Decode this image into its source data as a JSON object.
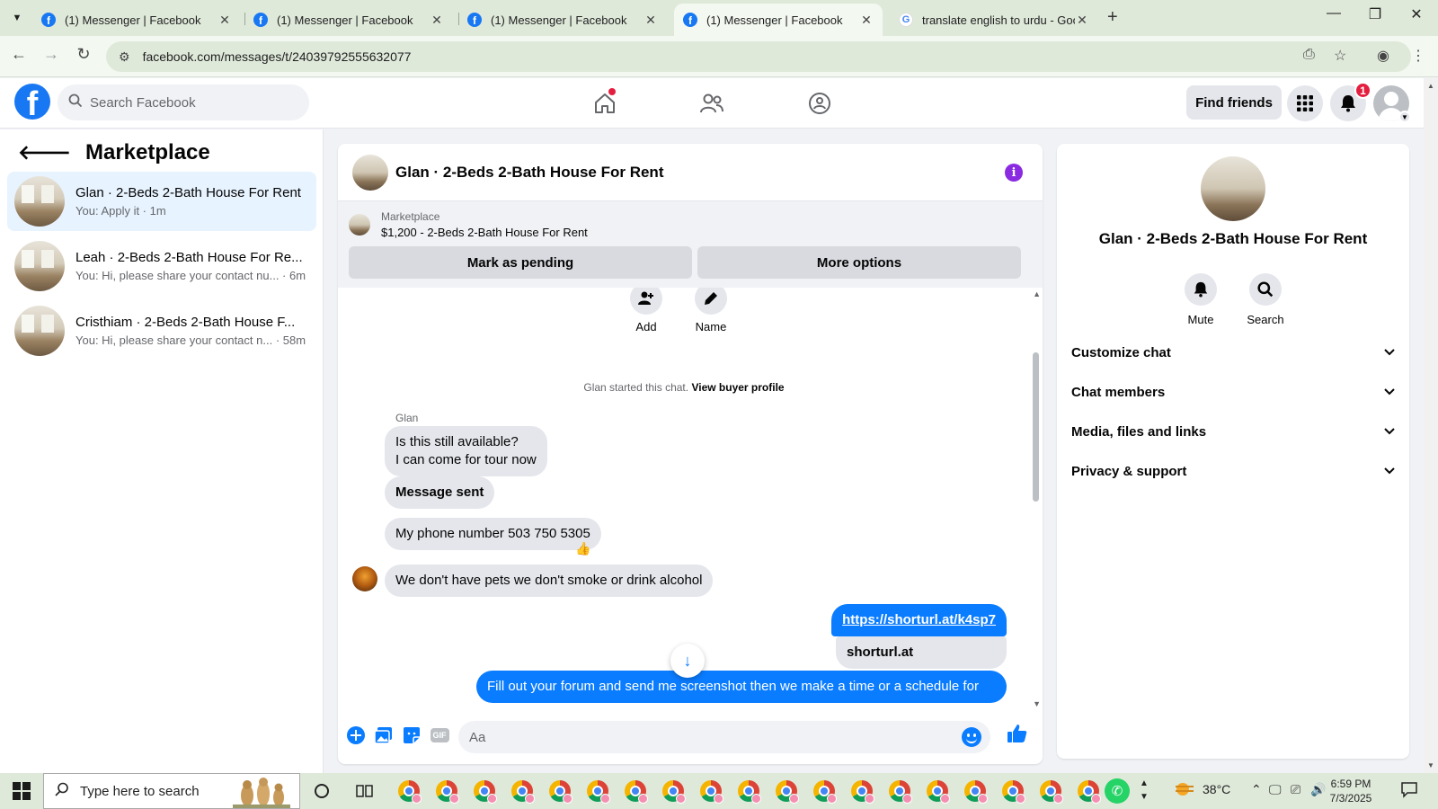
{
  "browser": {
    "tabs": [
      {
        "title": "(1) Messenger | Facebook",
        "active": false
      },
      {
        "title": "(1) Messenger | Facebook",
        "active": false
      },
      {
        "title": "(1) Messenger | Facebook",
        "active": false
      },
      {
        "title": "(1) Messenger | Facebook",
        "active": true
      },
      {
        "title": "translate english to urdu - Goo",
        "active": false
      }
    ],
    "url": "facebook.com/messages/t/24039792555632077"
  },
  "fb_header": {
    "logo": "f",
    "search_placeholder": "Search Facebook",
    "find_friends_label": "Find friends",
    "notification_count": "1"
  },
  "sidebar": {
    "title": "Marketplace",
    "conversations": [
      {
        "name": "Glan · 2-Beds 2-Bath House For Rent",
        "preview": "You: Apply it · 1m",
        "active": true
      },
      {
        "name": "Leah · 2-Beds 2-Bath House For Re...",
        "preview": "You: Hi, please share your contact nu... · 6m",
        "active": false
      },
      {
        "name": "Cristhiam · 2-Beds 2-Bath House F...",
        "preview": "You: Hi, please share your contact n... · 58m",
        "active": false
      }
    ]
  },
  "chat": {
    "title": "Glan · 2-Beds 2-Bath House For Rent",
    "info_icon": "i",
    "marketplace_label": "Marketplace",
    "listing": "$1,200 - 2-Beds 2-Bath House For Rent",
    "mark_pending_label": "Mark as pending",
    "more_options_label": "More options",
    "actions": {
      "add": "Add",
      "name": "Name"
    },
    "system_text": "Glan started this chat.",
    "system_link": "View buyer profile",
    "sender_name": "Glan",
    "messages": {
      "m1": "Is this still available?",
      "m1b": "I can come for tour now",
      "m2": "Message sent",
      "m3": "My phone number 503 750 5305",
      "m4": "We don't have pets we don't smoke or drink alcohol",
      "out_link": "https://shorturl.at/k4sp7",
      "out_preview": "shorturl.at",
      "out_text": "Fill out your forum and send me screenshot then we make a time or a schedule for"
    },
    "reaction": "👍",
    "composer_placeholder": "Aa",
    "gif_label": "GIF"
  },
  "right_panel": {
    "name": "Glan · 2-Beds 2-Bath House For Rent",
    "mute_label": "Mute",
    "search_label": "Search",
    "sections": [
      "Customize chat",
      "Chat members",
      "Media, files and links",
      "Privacy & support"
    ]
  },
  "taskbar": {
    "search_placeholder": "Type here to search",
    "temperature": "38°C",
    "time": "6:59 PM",
    "date": "7/3/2025"
  },
  "colors": {
    "fb_blue": "#1877f2",
    "messenger_blue": "#0a7cff",
    "info_purple": "#8a2be2"
  }
}
